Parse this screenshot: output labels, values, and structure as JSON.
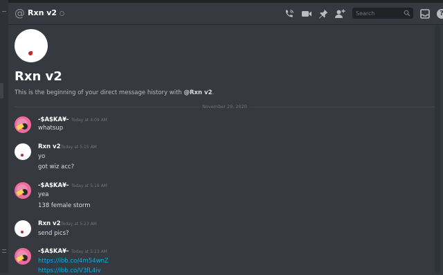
{
  "header": {
    "title": "Rxn v2",
    "search_placeholder": "Search",
    "icons": [
      "at-icon",
      "status-icon",
      "call-icon",
      "video-icon",
      "pin-icon",
      "add-friend-icon",
      "search-icon",
      "inbox-icon",
      "help-icon"
    ],
    "help_glyph": "?"
  },
  "intro": {
    "name": "Rxn v2",
    "text_prefix": "This is the beginning of your direct message history with ",
    "mention": "@Rxn v2",
    "text_suffix": "."
  },
  "divider_date": "November 29, 2020",
  "messages": [
    {
      "author": "-$A$KA¥-",
      "time": "Today at 4:09 AM",
      "lines": [
        "whatsup"
      ]
    },
    {
      "author": "Rxn v2",
      "time": "Today at 5:15 AM",
      "lines": [
        "yo",
        "got wiz acc?"
      ]
    },
    {
      "author": "-$A$KA¥-",
      "time": "Today at 5:19 AM",
      "lines": [
        "yea",
        "138 female storm"
      ]
    },
    {
      "author": "Rxn v2",
      "time": "Today at 5:23 AM",
      "lines": [
        "send pics?"
      ]
    },
    {
      "author": "-$A$KA¥-",
      "time": "Today at 5:23 AM",
      "lines": [
        "https://ibb.co/4m54wnZ",
        "https://ibb.co/V3fL4iv"
      ]
    }
  ],
  "colors": {
    "background": "#36393f",
    "link": "#00b0f4",
    "header_text": "#ffffff"
  }
}
